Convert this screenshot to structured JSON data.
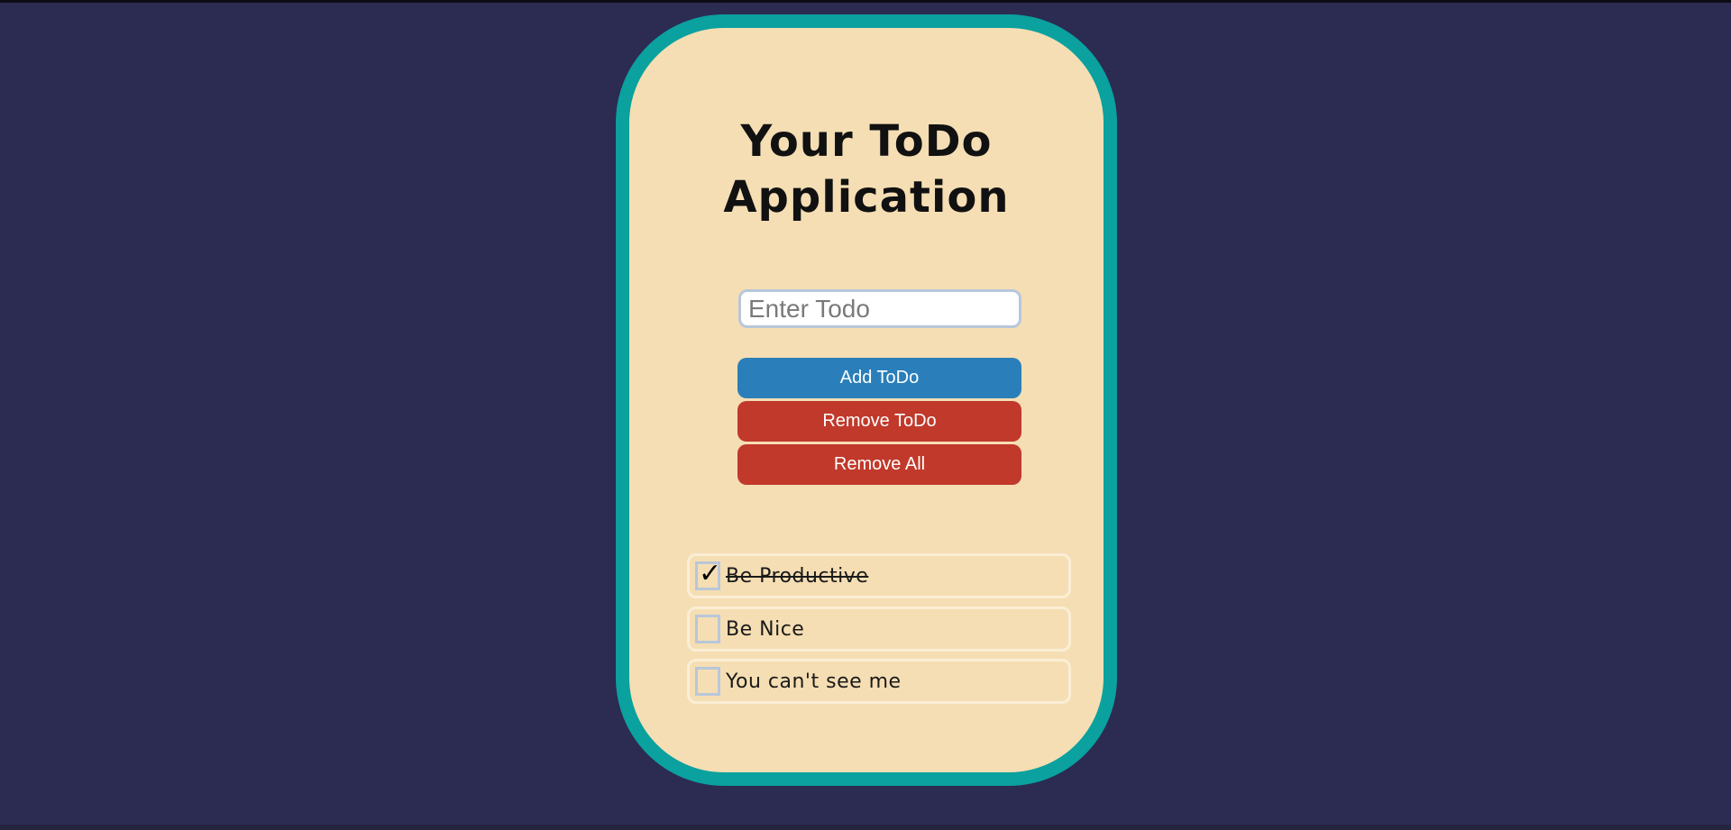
{
  "app": {
    "title": "Your ToDo Application"
  },
  "input": {
    "placeholder": "Enter Todo",
    "value": ""
  },
  "buttons": {
    "add": "Add ToDo",
    "remove": "Remove ToDo",
    "remove_all": "Remove All"
  },
  "todos": [
    {
      "text": "Be Productive",
      "checked": true
    },
    {
      "text": "Be Nice",
      "checked": false
    },
    {
      "text": "You can't see me",
      "checked": false
    }
  ],
  "icons": {
    "check": "checkmark-icon"
  },
  "colors": {
    "background": "#2c2b51",
    "card": "#f5deb3",
    "card_border": "#0aa19f",
    "add_button": "#2a7fba",
    "remove_button": "#c0392b"
  }
}
